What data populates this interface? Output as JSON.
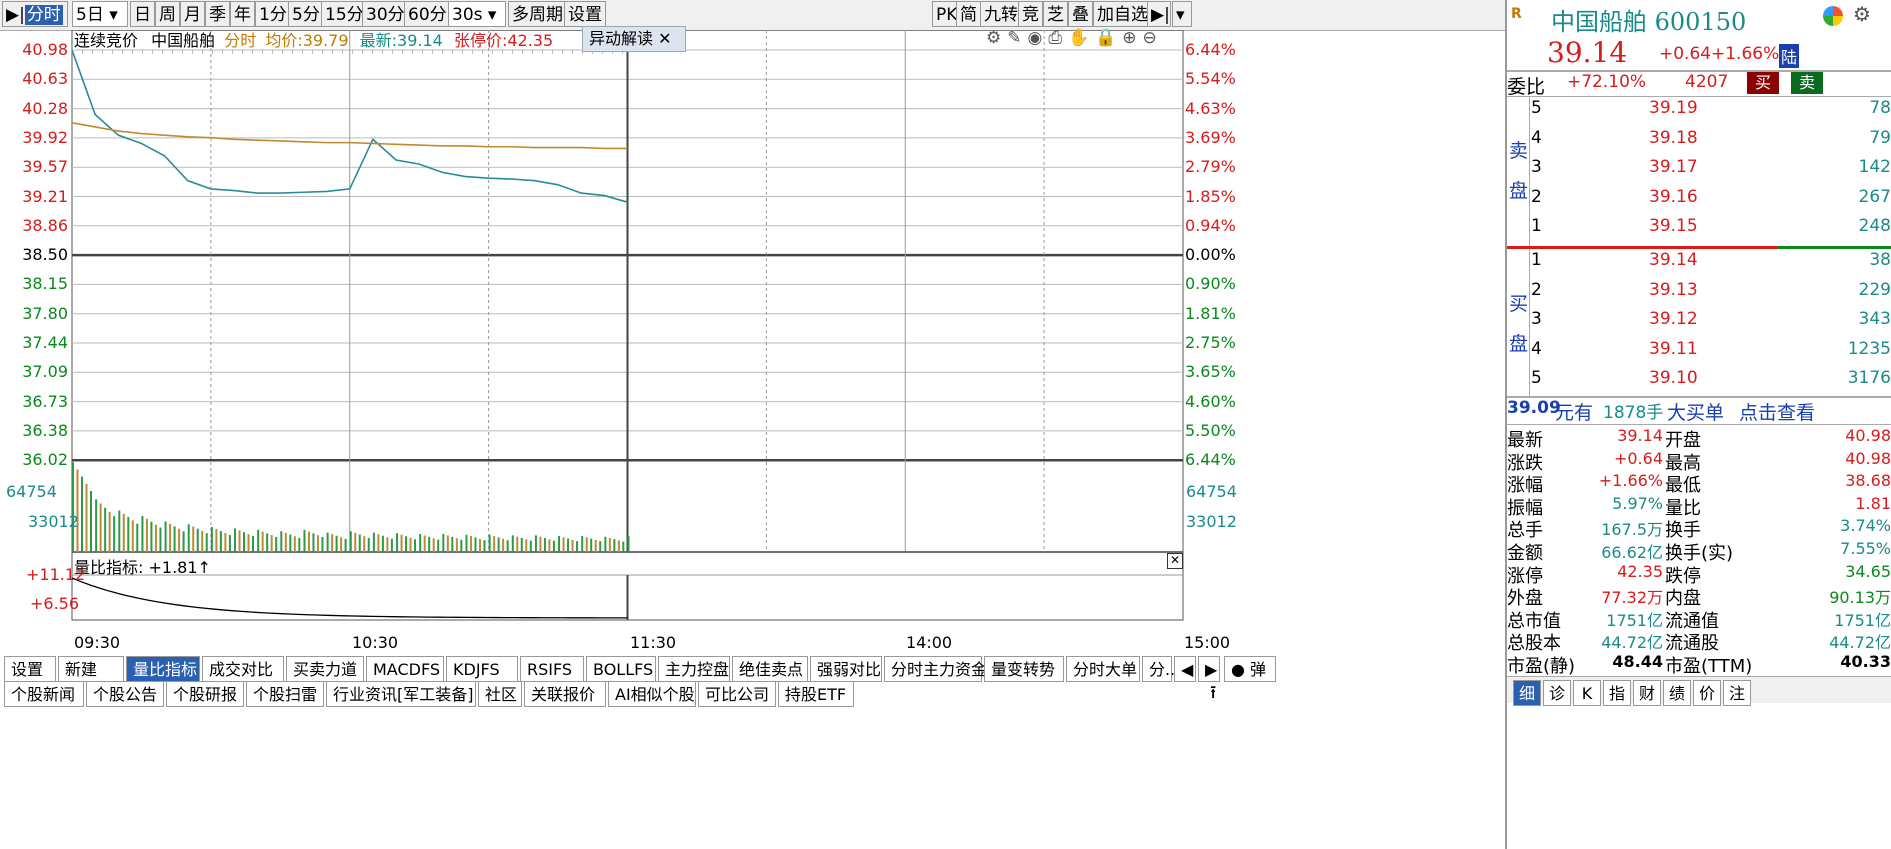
{
  "toolbar": {
    "items": [
      "分时",
      "5日",
      "日",
      "周",
      "月",
      "季",
      "年",
      "1分",
      "5分",
      "15分",
      "30分",
      "60分",
      "30s",
      "多周期",
      "设置"
    ],
    "right_items": [
      "PK",
      "简",
      "九转",
      "竞",
      "芝",
      "叠",
      "加自选"
    ]
  },
  "chart_header": {
    "mode": "连续竞价",
    "name": "中国船舶",
    "type": "分时",
    "avg_label": "均价:",
    "avg_value": "39.79",
    "last_label": "最新:",
    "last_value": "39.14",
    "limit_label": "张停价:",
    "limit_value": "42.35",
    "anomaly_btn": "异动解读"
  },
  "price_axis": [
    "40.98",
    "40.63",
    "40.28",
    "39.92",
    "39.57",
    "39.21",
    "38.86",
    "38.50",
    "38.15",
    "37.80",
    "37.44",
    "37.09",
    "36.73",
    "36.38",
    "36.02"
  ],
  "pct_axis": [
    "6.44%",
    "5.54%",
    "4.63%",
    "3.69%",
    "2.79%",
    "1.85%",
    "0.94%",
    "0.00%",
    "0.90%",
    "1.81%",
    "2.75%",
    "3.65%",
    "4.60%",
    "5.50%",
    "6.44%"
  ],
  "volume_axis": [
    "64754",
    "33012"
  ],
  "indicator": {
    "title": "量比指标: +1.81↑",
    "axis_top": "+11.12",
    "axis_mid": "+6.56"
  },
  "time_axis": [
    "09:30",
    "10:30",
    "11:30",
    "14:00",
    "15:00"
  ],
  "chart_data": {
    "type": "line",
    "x": [
      "09:30",
      "09:35",
      "09:40",
      "09:45",
      "09:50",
      "09:55",
      "10:00",
      "10:05",
      "10:10",
      "10:15",
      "10:20",
      "10:25",
      "10:30",
      "10:35",
      "10:40",
      "10:45",
      "10:50",
      "10:55",
      "11:00",
      "11:05",
      "11:10",
      "11:15",
      "11:20",
      "11:25",
      "11:30"
    ],
    "series": [
      {
        "name": "价格",
        "values": [
          40.98,
          40.2,
          39.95,
          39.85,
          39.7,
          39.4,
          39.3,
          39.28,
          39.25,
          39.25,
          39.26,
          39.27,
          39.3,
          39.9,
          39.65,
          39.6,
          39.5,
          39.45,
          39.43,
          39.42,
          39.4,
          39.35,
          39.25,
          39.22,
          39.14
        ]
      },
      {
        "name": "均价",
        "values": [
          40.1,
          40.05,
          40.0,
          39.97,
          39.95,
          39.93,
          39.92,
          39.9,
          39.89,
          39.88,
          39.87,
          39.86,
          39.86,
          39.85,
          39.84,
          39.83,
          39.82,
          39.82,
          39.81,
          39.81,
          39.8,
          39.8,
          39.8,
          39.79,
          39.79
        ]
      }
    ],
    "ylim": [
      36.02,
      40.98
    ],
    "baseline": 38.5,
    "volume": [
      64754,
      38000,
      30000,
      26000,
      22000,
      20000,
      18000,
      17000,
      16000,
      15000,
      16000,
      14000,
      15000,
      14000,
      13500,
      13000,
      13000,
      12500,
      12500,
      12000,
      12000,
      11500,
      11500,
      11000,
      11500
    ]
  },
  "bottom_tabs": [
    "设置",
    "新建",
    "量比指标",
    "成交对比",
    "买卖力道",
    "MACDFS",
    "KDJFS",
    "RSIFS",
    "BOLLFS",
    "主力控盘",
    "绝佳卖点",
    "强弱对比",
    "分时主力资金",
    "量变转势",
    "分时大单",
    "分..."
  ],
  "news_tabs": [
    "个股新闻",
    "个股公告",
    "个股研报",
    "个股扫雷",
    "行业资讯[军工装备]",
    "社区",
    "关联报价",
    "AI相似个股",
    "可比公司",
    "持股ETF"
  ],
  "panel": {
    "name": "中国船舶",
    "code": "600150",
    "price": "39.14",
    "change": "+0.64",
    "change_pct": "+1.66%",
    "market_tag": "陆",
    "weibi_label": "委比",
    "weibi_value": "+72.10%",
    "weicha": "4207",
    "buy_btn": "买",
    "sell_btn": "卖",
    "sell_label_top": "卖",
    "sell_label_bottom": "盘",
    "buy_label_top": "买",
    "buy_label_bottom": "盘",
    "asks": [
      {
        "level": "5",
        "price": "39.19",
        "vol": "78"
      },
      {
        "level": "4",
        "price": "39.18",
        "vol": "79"
      },
      {
        "level": "3",
        "price": "39.17",
        "vol": "142"
      },
      {
        "level": "2",
        "price": "39.16",
        "vol": "267"
      },
      {
        "level": "1",
        "price": "39.15",
        "vol": "248"
      }
    ],
    "bids": [
      {
        "level": "1",
        "price": "39.14",
        "vol": "38"
      },
      {
        "level": "2",
        "price": "39.13",
        "vol": "229"
      },
      {
        "level": "3",
        "price": "39.12",
        "vol": "343"
      },
      {
        "level": "4",
        "price": "39.11",
        "vol": "1235"
      },
      {
        "level": "5",
        "price": "39.10",
        "vol": "3176"
      }
    ],
    "bigorder": {
      "price": "39.09",
      "unit": "元有",
      "qty": "1878手",
      "label": "大买单",
      "link": "点击查看"
    },
    "stats": [
      {
        "l1": "最新",
        "v1": "39.14",
        "c1": "red",
        "l2": "开盘",
        "v2": "40.98",
        "c2": "red"
      },
      {
        "l1": "涨跌",
        "v1": "+0.64",
        "c1": "red",
        "l2": "最高",
        "v2": "40.98",
        "c2": "red"
      },
      {
        "l1": "涨幅",
        "v1": "+1.66%",
        "c1": "red",
        "l2": "最低",
        "v2": "38.68",
        "c2": "red"
      },
      {
        "l1": "振幅",
        "v1": "5.97%",
        "c1": "teal",
        "l2": "量比",
        "v2": "1.81",
        "c2": "red"
      },
      {
        "l1": "总手",
        "v1": "167.5万",
        "c1": "teal",
        "l2": "换手",
        "v2": "3.74%",
        "c2": "teal"
      },
      {
        "l1": "金额",
        "v1": "66.62亿",
        "c1": "teal",
        "l2": "换手(实)",
        "v2": "7.55%",
        "c2": "teal"
      },
      {
        "l1": "涨停",
        "v1": "42.35",
        "c1": "red",
        "l2": "跌停",
        "v2": "34.65",
        "c2": "green"
      },
      {
        "l1": "外盘",
        "v1": "77.32万",
        "c1": "red",
        "l2": "内盘",
        "v2": "90.13万",
        "c2": "green"
      },
      {
        "l1": "总市值",
        "v1": "1751亿",
        "c1": "teal",
        "l2": "流通值",
        "v2": "1751亿",
        "c2": "teal"
      },
      {
        "l1": "总股本",
        "v1": "44.72亿",
        "c1": "teal",
        "l2": "流通股",
        "v2": "44.72亿",
        "c2": "teal"
      },
      {
        "l1": "市盈(静)",
        "v1": "48.44",
        "c1": "black",
        "l2": "市盈(TTM)",
        "v2": "40.33",
        "c2": "black"
      }
    ],
    "bottom_tabs": [
      "细",
      "诊",
      "K",
      "指",
      "财",
      "绩",
      "价",
      "注"
    ]
  }
}
